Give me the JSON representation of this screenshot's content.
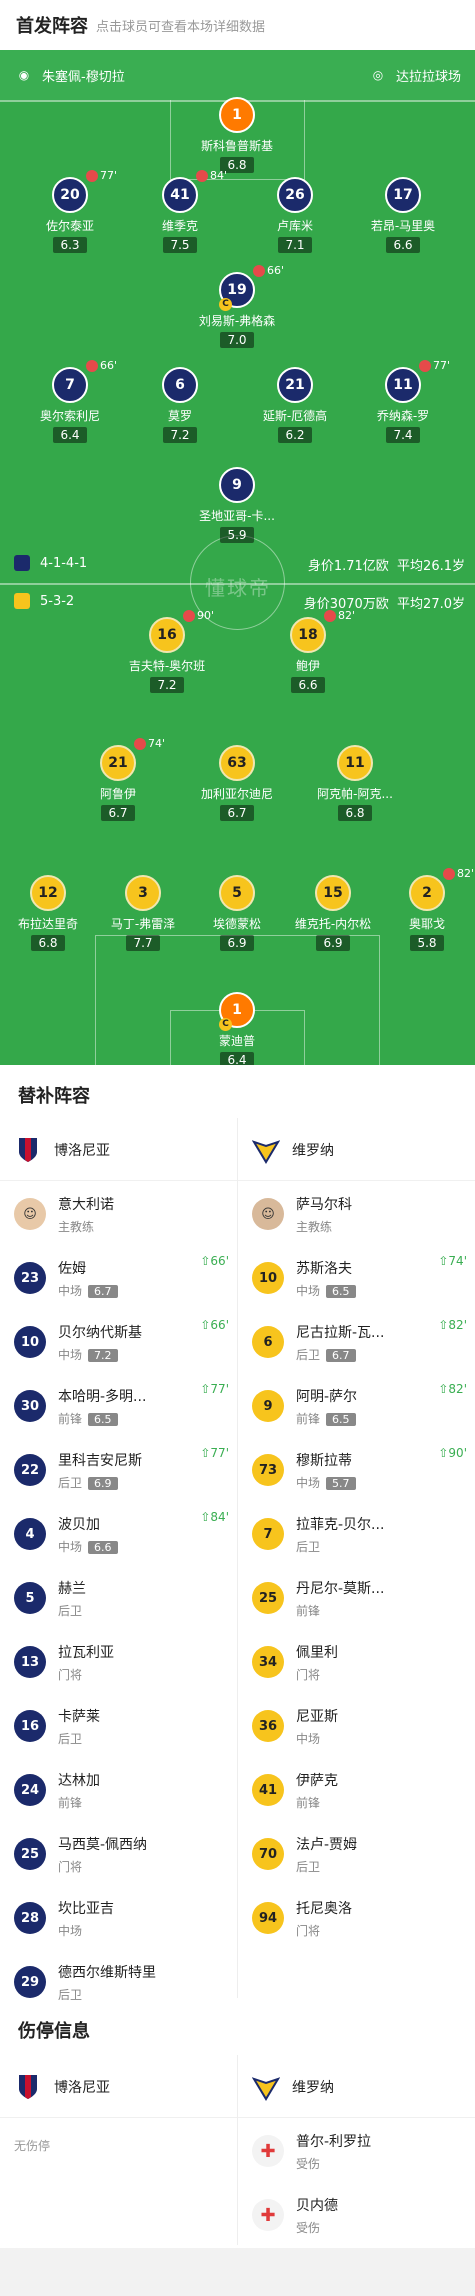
{
  "header": {
    "title": "首发阵容",
    "subtitle": "点击球员可查看本场详细数据"
  },
  "pitch": {
    "home_team": "朱塞佩-穆切拉",
    "away_team": "达拉拉球场",
    "home_formation": "4-1-4-1",
    "away_formation": "5-3-2",
    "home_value": "身价1.71亿欧",
    "home_age": "平均26.1岁",
    "away_value": "身价3070万欧",
    "away_age": "平均27.0岁",
    "watermark": "懂球帝"
  },
  "home_players": [
    {
      "num": "1",
      "name": "斯科鲁普斯基",
      "rating": "6.8"
    },
    {
      "num": "20",
      "name": "佐尔泰亚",
      "rating": "6.3",
      "sub": "77'"
    },
    {
      "num": "41",
      "name": "维季克",
      "rating": "7.5",
      "sub": "84'"
    },
    {
      "num": "26",
      "name": "卢库米",
      "rating": "7.1"
    },
    {
      "num": "17",
      "name": "若昂-马里奥",
      "rating": "6.6"
    },
    {
      "num": "19",
      "name": "刘易斯-弗格森",
      "rating": "7.0",
      "sub": "66'"
    },
    {
      "num": "7",
      "name": "奥尔索利尼",
      "rating": "6.4",
      "sub": "66'"
    },
    {
      "num": "6",
      "name": "莫罗",
      "rating": "7.2"
    },
    {
      "num": "21",
      "name": "延斯-厄德高",
      "rating": "6.2"
    },
    {
      "num": "11",
      "name": "乔纳森-罗",
      "rating": "7.4",
      "sub": "77'"
    },
    {
      "num": "9",
      "name": "圣地亚哥-卡...",
      "rating": "5.9"
    }
  ],
  "away_players": [
    {
      "num": "16",
      "name": "吉夫特-奥尔班",
      "rating": "7.2",
      "sub": "90'"
    },
    {
      "num": "18",
      "name": "鲍伊",
      "rating": "6.6",
      "sub": "82'"
    },
    {
      "num": "21",
      "name": "阿鲁伊",
      "rating": "6.7",
      "sub": "74'"
    },
    {
      "num": "63",
      "name": "加利亚尔迪尼",
      "rating": "6.7"
    },
    {
      "num": "11",
      "name": "阿克帕-阿克...",
      "rating": "6.8"
    },
    {
      "num": "12",
      "name": "布拉达里奇",
      "rating": "6.8"
    },
    {
      "num": "3",
      "name": "马丁-弗雷泽",
      "rating": "7.7"
    },
    {
      "num": "5",
      "name": "埃德蒙松",
      "rating": "6.9"
    },
    {
      "num": "15",
      "name": "维克托-内尔松",
      "rating": "6.9"
    },
    {
      "num": "2",
      "name": "奥耶戈",
      "rating": "5.8",
      "sub": "82'"
    },
    {
      "num": "1",
      "name": "蒙迪普",
      "rating": "6.4"
    }
  ],
  "subs": {
    "title": "替补阵容",
    "home_team": "博洛尼亚",
    "away_team": "维罗纳",
    "home_coach": {
      "name": "意大利诺",
      "role": "主教练"
    },
    "away_coach": {
      "name": "萨马尔科",
      "role": "主教练"
    },
    "home": [
      {
        "num": "23",
        "name": "佐姆",
        "pos": "中场",
        "rating": "6.7",
        "in": "66'"
      },
      {
        "num": "10",
        "name": "贝尔纳代斯基",
        "pos": "中场",
        "rating": "7.2",
        "in": "66'"
      },
      {
        "num": "30",
        "name": "本哈明-多明...",
        "pos": "前锋",
        "rating": "6.5",
        "in": "77'"
      },
      {
        "num": "22",
        "name": "里科吉安尼斯",
        "pos": "后卫",
        "rating": "6.9",
        "in": "77'"
      },
      {
        "num": "4",
        "name": "波贝加",
        "pos": "中场",
        "rating": "6.6",
        "in": "84'"
      },
      {
        "num": "5",
        "name": "赫兰",
        "pos": "后卫"
      },
      {
        "num": "13",
        "name": "拉瓦利亚",
        "pos": "门将"
      },
      {
        "num": "16",
        "name": "卡萨莱",
        "pos": "后卫"
      },
      {
        "num": "24",
        "name": "达林加",
        "pos": "前锋"
      },
      {
        "num": "25",
        "name": "马西莫-佩西纳",
        "pos": "门将"
      },
      {
        "num": "28",
        "name": "坎比亚吉",
        "pos": "中场"
      },
      {
        "num": "29",
        "name": "德西尔维斯特里",
        "pos": "后卫"
      }
    ],
    "away": [
      {
        "num": "10",
        "name": "苏斯洛夫",
        "pos": "中场",
        "rating": "6.5",
        "in": "74'"
      },
      {
        "num": "6",
        "name": "尼古拉斯-瓦...",
        "pos": "后卫",
        "rating": "6.7",
        "in": "82'"
      },
      {
        "num": "9",
        "name": "阿明-萨尔",
        "pos": "前锋",
        "rating": "6.5",
        "in": "82'"
      },
      {
        "num": "73",
        "name": "穆斯拉蒂",
        "pos": "中场",
        "rating": "5.7",
        "in": "90'"
      },
      {
        "num": "7",
        "name": "拉菲克-贝尔...",
        "pos": "后卫"
      },
      {
        "num": "25",
        "name": "丹尼尔-莫斯...",
        "pos": "前锋"
      },
      {
        "num": "34",
        "name": "佩里利",
        "pos": "门将"
      },
      {
        "num": "36",
        "name": "尼亚斯",
        "pos": "中场"
      },
      {
        "num": "41",
        "name": "伊萨克",
        "pos": "前锋"
      },
      {
        "num": "70",
        "name": "法卢-贾姆",
        "pos": "后卫"
      },
      {
        "num": "94",
        "name": "托尼奥洛",
        "pos": "门将"
      }
    ]
  },
  "injuries": {
    "title": "伤停信息",
    "home_team": "博洛尼亚",
    "away_team": "维罗纳",
    "home_none": "无伤停",
    "away": [
      {
        "name": "普尔-利罗拉",
        "status": "受伤"
      },
      {
        "name": "贝内德",
        "status": "受伤"
      }
    ]
  }
}
